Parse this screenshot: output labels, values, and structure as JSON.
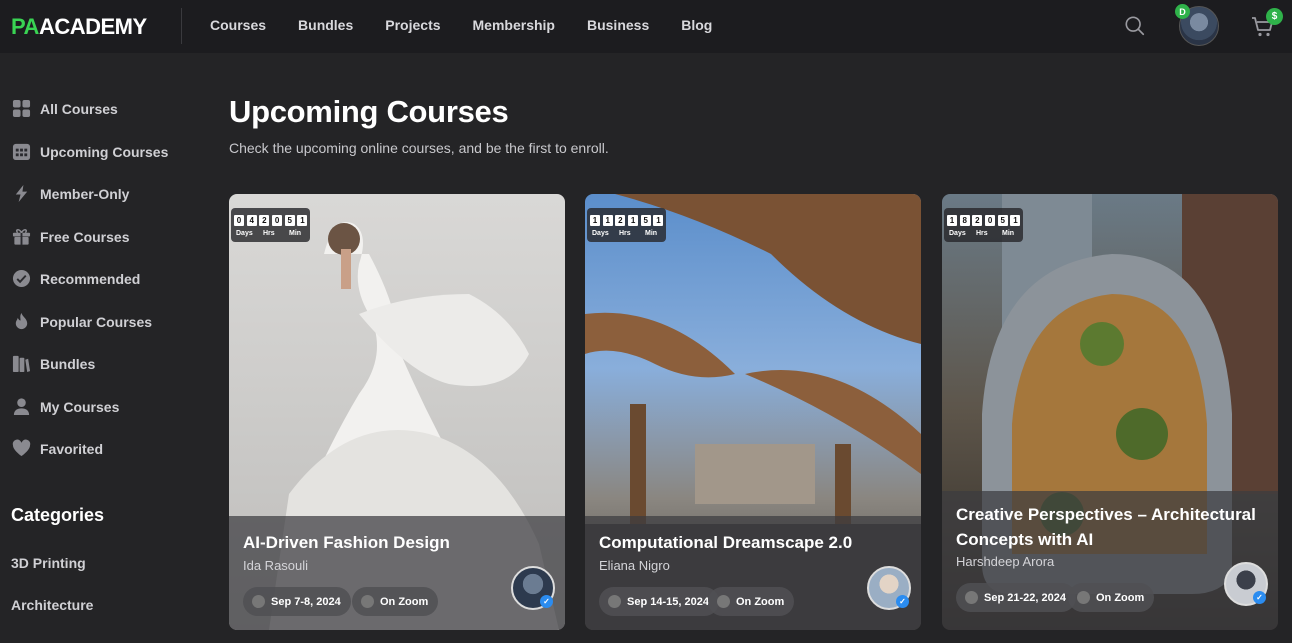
{
  "header": {
    "logo_pa": "PA",
    "logo_rest": "ACADEMY",
    "nav": [
      "Courses",
      "Bundles",
      "Projects",
      "Membership",
      "Business",
      "Blog"
    ],
    "user_badge": "D",
    "cart_badge": "$"
  },
  "sidebar": {
    "items": [
      {
        "label": "All Courses",
        "icon": "grid-icon"
      },
      {
        "label": "Upcoming Courses",
        "icon": "calendar-icon"
      },
      {
        "label": "Member-Only",
        "icon": "bolt-icon"
      },
      {
        "label": "Free Courses",
        "icon": "gift-icon"
      },
      {
        "label": "Recommended",
        "icon": "check-badge-icon"
      },
      {
        "label": "Popular Courses",
        "icon": "flame-icon"
      },
      {
        "label": "Bundles",
        "icon": "books-icon"
      },
      {
        "label": "My Courses",
        "icon": "person-icon"
      },
      {
        "label": "Favorited",
        "icon": "heart-icon"
      }
    ],
    "categories_title": "Categories",
    "categories": [
      "3D Printing",
      "Architecture"
    ]
  },
  "main": {
    "title": "Upcoming Courses",
    "subtitle": "Check the upcoming online courses, and be the first to enroll."
  },
  "cards": [
    {
      "title_line1": "AI-Driven Fashion Design",
      "title_line2": "",
      "author": "Ida Rasouli",
      "date": "Sep 7-8, 2024",
      "location": "On Zoom",
      "timer_digits": [
        "0",
        "4",
        "2",
        "0",
        "5",
        "1"
      ],
      "timer_labels": [
        "Days",
        "Hrs",
        "Min"
      ]
    },
    {
      "title_line1": "Computational Dreamscape 2.0",
      "title_line2": "",
      "author": "Eliana Nigro",
      "date": "Sep 14-15, 2024",
      "location": "On Zoom",
      "timer_digits": [
        "1",
        "1",
        "2",
        "1",
        "5",
        "1"
      ],
      "timer_labels": [
        "Days",
        "Hrs",
        "Min"
      ]
    },
    {
      "title_line1": "Creative Perspectives – Architectural",
      "title_line2": "Concepts with AI",
      "author": "Harshdeep Arora",
      "date": "Sep 21-22, 2024",
      "location": "On Zoom",
      "timer_digits": [
        "1",
        "8",
        "2",
        "0",
        "5",
        "1"
      ],
      "timer_labels": [
        "Days",
        "Hrs",
        "Min"
      ]
    }
  ],
  "colors": {
    "brand_green": "#39d353",
    "background": "#242426",
    "topbar": "#1c1c1f"
  }
}
